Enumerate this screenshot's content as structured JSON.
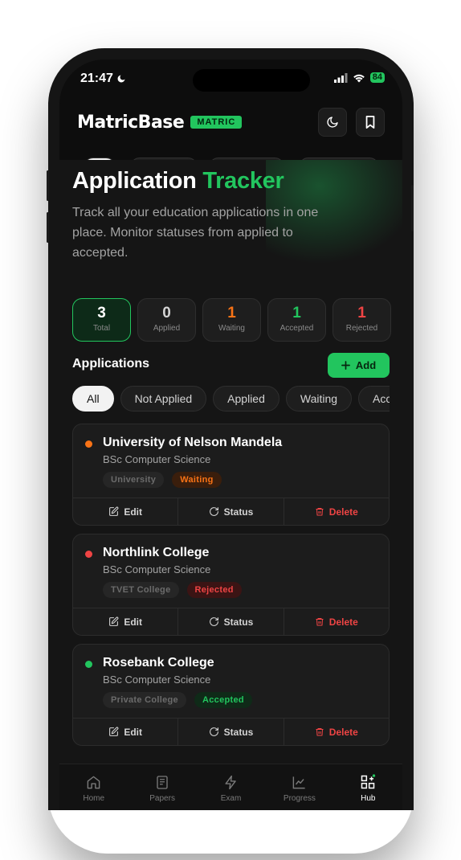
{
  "status_bar": {
    "time": "21:47",
    "battery": "84"
  },
  "header": {
    "logo": "MatricBase",
    "badge": "MATRIC"
  },
  "page": {
    "title_main": "Application",
    "title_accent": "Tracker",
    "subtitle": "Track all your education applications in one place. Monitor statuses from applied to accepted."
  },
  "stats": [
    {
      "value": "3",
      "label": "Total",
      "color": "#ffffff"
    },
    {
      "value": "0",
      "label": "Applied",
      "color": "#d4d4d4"
    },
    {
      "value": "1",
      "label": "Waiting",
      "color": "#f97316"
    },
    {
      "value": "1",
      "label": "Accepted",
      "color": "#22c55e"
    },
    {
      "value": "1",
      "label": "Rejected",
      "color": "#ef4444"
    }
  ],
  "section": {
    "title": "Applications",
    "add_label": "Add"
  },
  "filters": [
    "All",
    "Not Applied",
    "Applied",
    "Waiting",
    "Accepted"
  ],
  "applications": [
    {
      "name": "University of Nelson Mandela",
      "course": "BSc Computer Science",
      "type": "University",
      "status": "Waiting",
      "dot_color": "#f97316"
    },
    {
      "name": "Northlink College",
      "course": "BSc Computer Science",
      "type": "TVET College",
      "status": "Rejected",
      "dot_color": "#ef4444"
    },
    {
      "name": "Rosebank College",
      "course": "BSc Computer Science",
      "type": "Private College",
      "status": "Accepted",
      "dot_color": "#22c55e"
    }
  ],
  "card_actions": {
    "edit": "Edit",
    "status": "Status",
    "delete": "Delete"
  },
  "bottom_nav": [
    {
      "label": "Home",
      "icon": "home-icon"
    },
    {
      "label": "Papers",
      "icon": "papers-icon"
    },
    {
      "label": "Exam",
      "icon": "lightning-icon"
    },
    {
      "label": "Progress",
      "icon": "chart-icon"
    },
    {
      "label": "Hub",
      "icon": "hub-icon"
    }
  ],
  "colors": {
    "accent": "#22c55e",
    "waiting": "#f97316",
    "rejected": "#ef4444"
  }
}
